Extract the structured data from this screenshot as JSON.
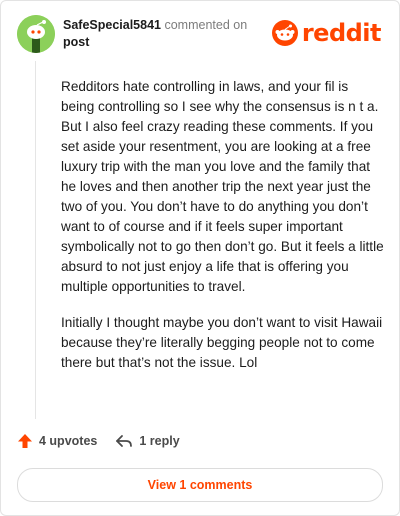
{
  "comment": {
    "author": "SafeSpecial5841",
    "action_text": "commented on",
    "target": "post",
    "brand": "reddit",
    "paragraphs": [
      "Redditors hate controlling in laws, and your fil is being controlling so I see why the consensus is n t a. But I also feel crazy reading these comments. If you set aside your resentment, you are looking at a free luxury trip with the man you love and the family that he loves and then another trip the next year just the two of you. You don’t have to do anything you don’t want to of course and if it feels super important symbolically not to go then don’t go. But it feels a little absurd to not just enjoy a life that is offering you multiple opportunities to travel.",
      "Initially I thought maybe you don’t want to visit Hawaii because they’re literally begging people not to come there but that’s not the issue. Lol"
    ]
  },
  "actions": {
    "upvotes_label": "4 upvotes",
    "reply_label": "1 reply",
    "view_comments_label": "View 1 comments"
  },
  "colors": {
    "accent": "#ff4500",
    "avatar_bg": "#8cd05a"
  },
  "icons": {
    "avatar": "snoo-avatar-icon",
    "logo": "reddit-logo-icon",
    "upvote": "upvote-arrow-icon",
    "reply": "reply-arrow-icon"
  }
}
